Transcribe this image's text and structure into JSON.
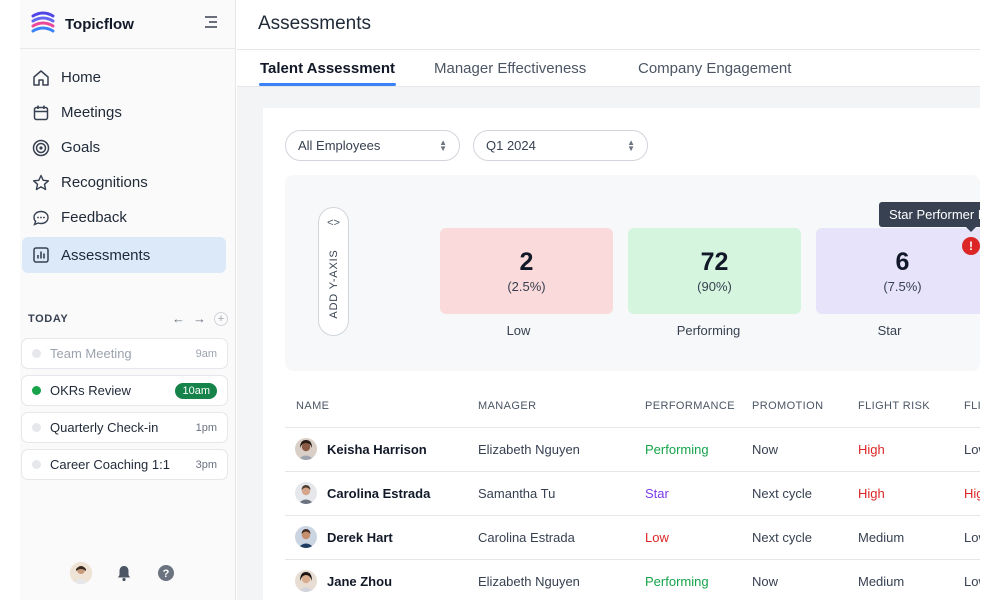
{
  "app": {
    "name": "Topicflow"
  },
  "sidebar": {
    "items": [
      {
        "label": "Home",
        "icon": "home-icon"
      },
      {
        "label": "Meetings",
        "icon": "calendar-icon"
      },
      {
        "label": "Goals",
        "icon": "target-icon"
      },
      {
        "label": "Recognitions",
        "icon": "star-icon"
      },
      {
        "label": "Feedback",
        "icon": "chat-bubble-icon"
      },
      {
        "label": "Assessments",
        "icon": "bar-chart-icon",
        "active": true
      }
    ],
    "today": {
      "title": "TODAY",
      "prev": "←",
      "next": "→",
      "add": "+"
    },
    "events": [
      {
        "label": "Team Meeting",
        "time": "9am",
        "state": "past"
      },
      {
        "label": "OKRs Review",
        "time": "10am",
        "state": "live"
      },
      {
        "label": "Quarterly Check-in",
        "time": "1pm",
        "state": "upcoming"
      },
      {
        "label": "Career Coaching 1:1",
        "time": "3pm",
        "state": "upcoming"
      }
    ]
  },
  "header": {
    "title": "Assessments"
  },
  "tabs": [
    {
      "label": "Talent Assessment",
      "active": true
    },
    {
      "label": "Manager Effectiveness"
    },
    {
      "label": "Company Engagement"
    }
  ],
  "filters": {
    "employees": "All Employees",
    "period": "Q1 2024"
  },
  "distribution": {
    "y_axis_button": "ADD Y-AXIS",
    "code_glyph": "<>",
    "buckets": [
      {
        "count": "2",
        "pct": "(2.5%)",
        "label": "Low",
        "color": "#fadadb"
      },
      {
        "count": "72",
        "pct": "(90%)",
        "label": "Performing",
        "color": "#d6f5df"
      },
      {
        "count": "6",
        "pct": "(7.5%)",
        "label": "Star",
        "color": "#e6e3fa"
      }
    ],
    "tooltip": "Star Performer Flight Risk",
    "alert": "!"
  },
  "table": {
    "columns": [
      "NAME",
      "MANAGER",
      "PERFORMANCE",
      "PROMOTION",
      "FLIGHT RISK",
      "FLI"
    ],
    "rows": [
      {
        "name": "Keisha Harrison",
        "manager": "Elizabeth Nguyen",
        "performance": "Performing",
        "promotion": "Now",
        "flight_risk": "High",
        "extra": "Low"
      },
      {
        "name": "Carolina Estrada",
        "manager": "Samantha Tu",
        "performance": "Star",
        "promotion": "Next cycle",
        "flight_risk": "High",
        "extra": "High"
      },
      {
        "name": "Derek Hart",
        "manager": "Carolina Estrada",
        "performance": "Low",
        "promotion": "Next cycle",
        "flight_risk": "Medium",
        "extra": "Low"
      },
      {
        "name": "Jane Zhou",
        "manager": "Elizabeth Nguyen",
        "performance": "Performing",
        "promotion": "Now",
        "flight_risk": "Medium",
        "extra": "Low"
      }
    ]
  },
  "colors": {
    "accent": "#3b82f6",
    "active_nav": "#dce9f8",
    "live_badge": "#16834a",
    "performing": "#16a34a",
    "star": "#7c3aed",
    "risk_high": "#dc2626"
  }
}
